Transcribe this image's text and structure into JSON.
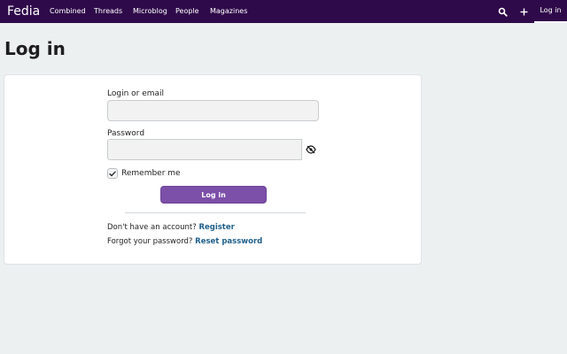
{
  "header": {
    "brand": "Fedia",
    "nav": [
      "Combined",
      "Threads",
      "Microblog",
      "People",
      "Magazines"
    ],
    "search_icon": "search-icon",
    "add_icon": "plus-icon",
    "login_label": "Log in"
  },
  "page": {
    "title": "Log in"
  },
  "form": {
    "login_label": "Login or email",
    "login_value": "",
    "password_label": "Password",
    "password_value": "",
    "show_password_icon": "eye-slash-icon",
    "remember_label": "Remember me",
    "remember_checked": true,
    "submit_label": "Log in"
  },
  "footer": {
    "no_account_text": "Don't have an account?",
    "register_label": "Register",
    "forgot_text": "Forgot your password?",
    "reset_label": "Reset password"
  },
  "colors": {
    "topbar": "#2f0a4a",
    "accent": "#7c4fa8",
    "link": "#1f5f8b",
    "page_background": "#ecf0f1"
  }
}
